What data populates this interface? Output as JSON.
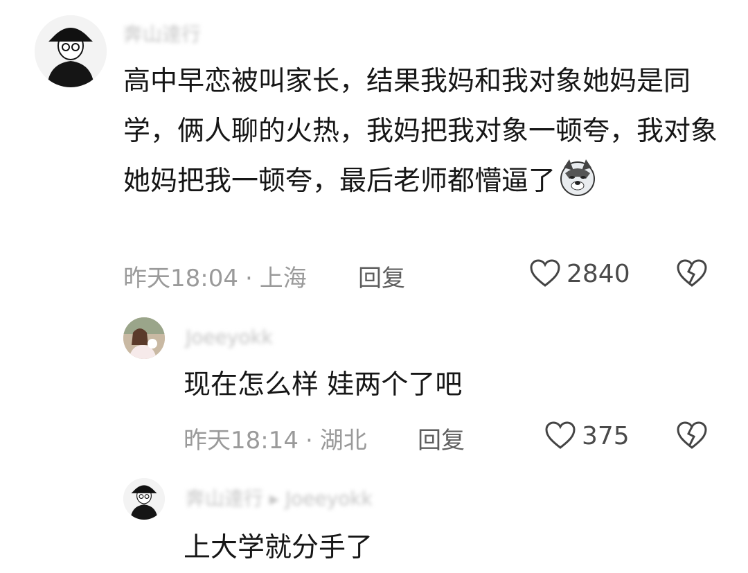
{
  "comments": [
    {
      "username": "奔山逹行",
      "text": "高中早恋被叫家长，结果我妈和我对象她妈是同学，俩人聊的火热，我妈把我对象一顿夸，我对象她妈把我一顿夸，最后老师都懵逼了",
      "emoji": "doge-emoji",
      "time": "昨天18:04",
      "sep": "·",
      "location": "上海",
      "reply_label": "回复",
      "likes": "2840"
    },
    {
      "username": "Joeeyokk",
      "text": "现在怎么样 娃两个了吧",
      "time": "昨天18:14",
      "sep": "·",
      "location": "湖北",
      "reply_label": "回复",
      "likes": "375"
    },
    {
      "username": "奔山逹行",
      "username_arrow": "▸",
      "reply_to": "Joeeyokk",
      "text": "上大学就分手了"
    }
  ],
  "icons": {
    "like": "heart-icon",
    "dislike": "broken-heart-icon"
  }
}
